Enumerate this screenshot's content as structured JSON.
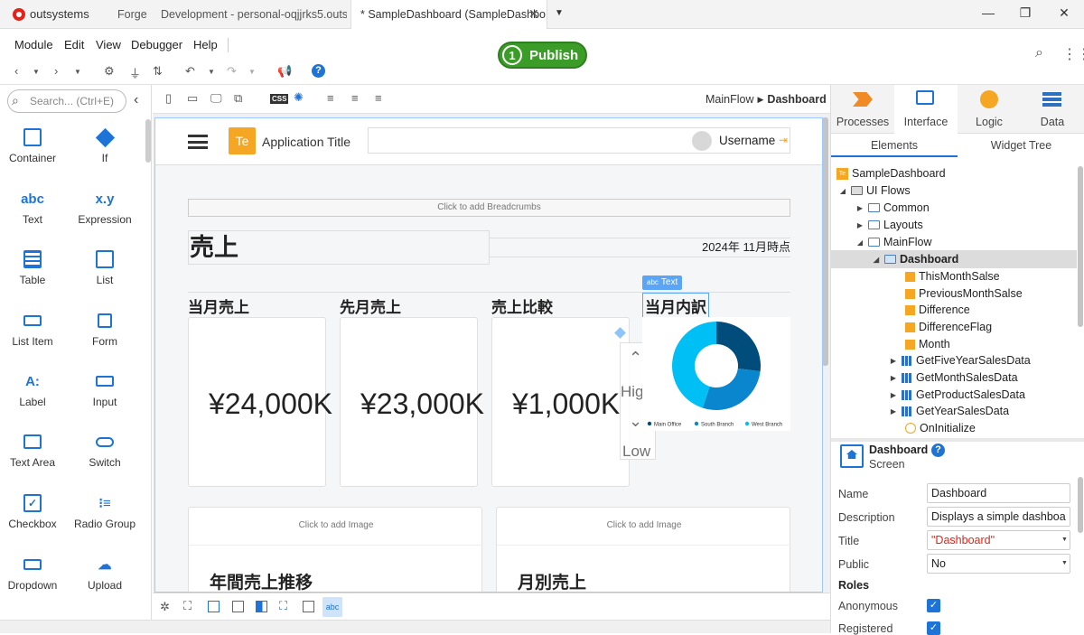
{
  "titlebar": {
    "brand": "outsystems",
    "tabs": [
      {
        "label": "Forge"
      },
      {
        "label": "Development - personal-oqjjrks5.outsy"
      },
      {
        "label": "* SampleDashboard (SampleDashbo"
      }
    ]
  },
  "menu": [
    "Module",
    "Edit",
    "View",
    "Debugger",
    "Help"
  ],
  "publish": {
    "step": "1",
    "label": "Publish"
  },
  "toolbox": {
    "search_placeholder": "Search... (Ctrl+E)",
    "widgets": [
      {
        "label": "Container",
        "icon": "container-icon"
      },
      {
        "label": "If",
        "icon": "if-icon"
      },
      {
        "label": "Text",
        "icon": "text-icon",
        "glyph": "abc"
      },
      {
        "label": "Expression",
        "icon": "expression-icon",
        "glyph": "x.y"
      },
      {
        "label": "Table",
        "icon": "table-icon"
      },
      {
        "label": "List",
        "icon": "list-icon"
      },
      {
        "label": "List Item",
        "icon": "list-item-icon"
      },
      {
        "label": "Form",
        "icon": "form-icon"
      },
      {
        "label": "Label",
        "icon": "label-icon",
        "glyph": "A:"
      },
      {
        "label": "Input",
        "icon": "input-icon"
      },
      {
        "label": "Text Area",
        "icon": "text-area-icon"
      },
      {
        "label": "Switch",
        "icon": "switch-icon"
      },
      {
        "label": "Checkbox",
        "icon": "checkbox-icon"
      },
      {
        "label": "Radio Group",
        "icon": "radio-group-icon"
      },
      {
        "label": "Dropdown",
        "icon": "dropdown-icon"
      },
      {
        "label": "Upload",
        "icon": "upload-icon"
      }
    ]
  },
  "canvas": {
    "breadcrumb_flow": "MainFlow",
    "breadcrumb_screen": "Dashboard",
    "app_logo": "Te",
    "app_title": "Application Title",
    "username": "Username",
    "breadcrumbs_placeholder": "Click to add Breadcrumbs",
    "page_title": "売上",
    "date_text": "2024年 11月時点",
    "cards": [
      {
        "title": "当月売上",
        "value": "¥24,000K"
      },
      {
        "title": "先月売上",
        "value": "¥23,000K"
      },
      {
        "title": "売上比較",
        "value": "¥1,000K"
      }
    ],
    "badge_text": "Text",
    "high_label": "Hig",
    "low_label": "Low",
    "donut_title": "当月内訳",
    "image_placeholder_1": "Click to add Image",
    "image_placeholder_2": "Click to add Image",
    "section_1": "年間売上推移",
    "section_2": "月別売上"
  },
  "chart_data": {
    "type": "pie",
    "categories": [
      "Main Office",
      "South Branch",
      "West Branch"
    ],
    "values": [
      27,
      28,
      45
    ],
    "colors": [
      "#004c7a",
      "#0a86cf",
      "#00bff5"
    ],
    "legend": "bottom"
  },
  "rightpanel": {
    "tabs": [
      "Processes",
      "Interface",
      "Logic",
      "Data"
    ],
    "subtabs": [
      "Elements",
      "Widget Tree"
    ],
    "tree": {
      "module": "SampleDashboard",
      "ui_flows": "UI Flows",
      "common": "Common",
      "layouts": "Layouts",
      "mainflow": "MainFlow",
      "dashboard": "Dashboard",
      "vars": [
        "ThisMonthSalse",
        "PreviousMonthSalse",
        "Difference",
        "DifferenceFlag",
        "Month"
      ],
      "aggregates": [
        "GetFiveYearSalesData",
        "GetMonthSalesData",
        "GetProductSalesData",
        "GetYearSalesData"
      ],
      "oninit": "OnInitialize"
    },
    "props": {
      "header_name": "Dashboard",
      "header_type": "Screen",
      "name_label": "Name",
      "name_value": "Dashboard",
      "desc_label": "Description",
      "desc_value": "Displays a simple dashboa ...",
      "title_label": "Title",
      "title_value": "\"Dashboard\"",
      "public_label": "Public",
      "public_value": "No",
      "roles_label": "Roles",
      "anonymous_label": "Anonymous",
      "registered_label": "Registered"
    }
  }
}
